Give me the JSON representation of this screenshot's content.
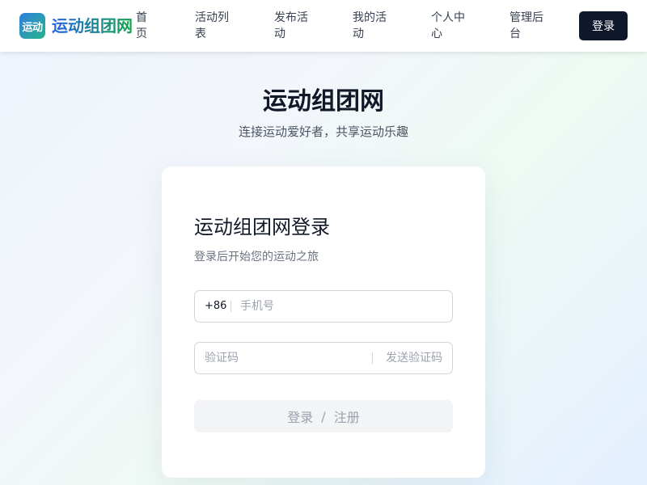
{
  "header": {
    "logo_badge": "运动",
    "site_name": "运动组团网",
    "nav": [
      {
        "line1": "首",
        "line2": "页"
      },
      {
        "line1": "活动列",
        "line2": "表"
      },
      {
        "line1": "发布活",
        "line2": "动"
      },
      {
        "line1": "我的活",
        "line2": "动"
      },
      {
        "line1": "个人中",
        "line2": "心"
      },
      {
        "line1": "管理后",
        "line2": "台"
      }
    ],
    "login_label": "登录"
  },
  "hero": {
    "title": "运动组团网",
    "subtitle": "连接运动爱好者，共享运动乐趣"
  },
  "login_card": {
    "title": "运动组团网登录",
    "subtitle": "登录后开始您的运动之旅",
    "phone": {
      "prefix": "+86",
      "placeholder": "手机号",
      "value": ""
    },
    "code": {
      "placeholder": "验证码",
      "value": "",
      "send_label": "发送验证码"
    },
    "submit": {
      "login": "登录",
      "separator": "/",
      "register": "注册"
    }
  },
  "colors": {
    "primary_dark": "#0f172a",
    "brand_blue": "#2563eb",
    "brand_green": "#16a34a",
    "muted_text": "#9ca3af"
  }
}
